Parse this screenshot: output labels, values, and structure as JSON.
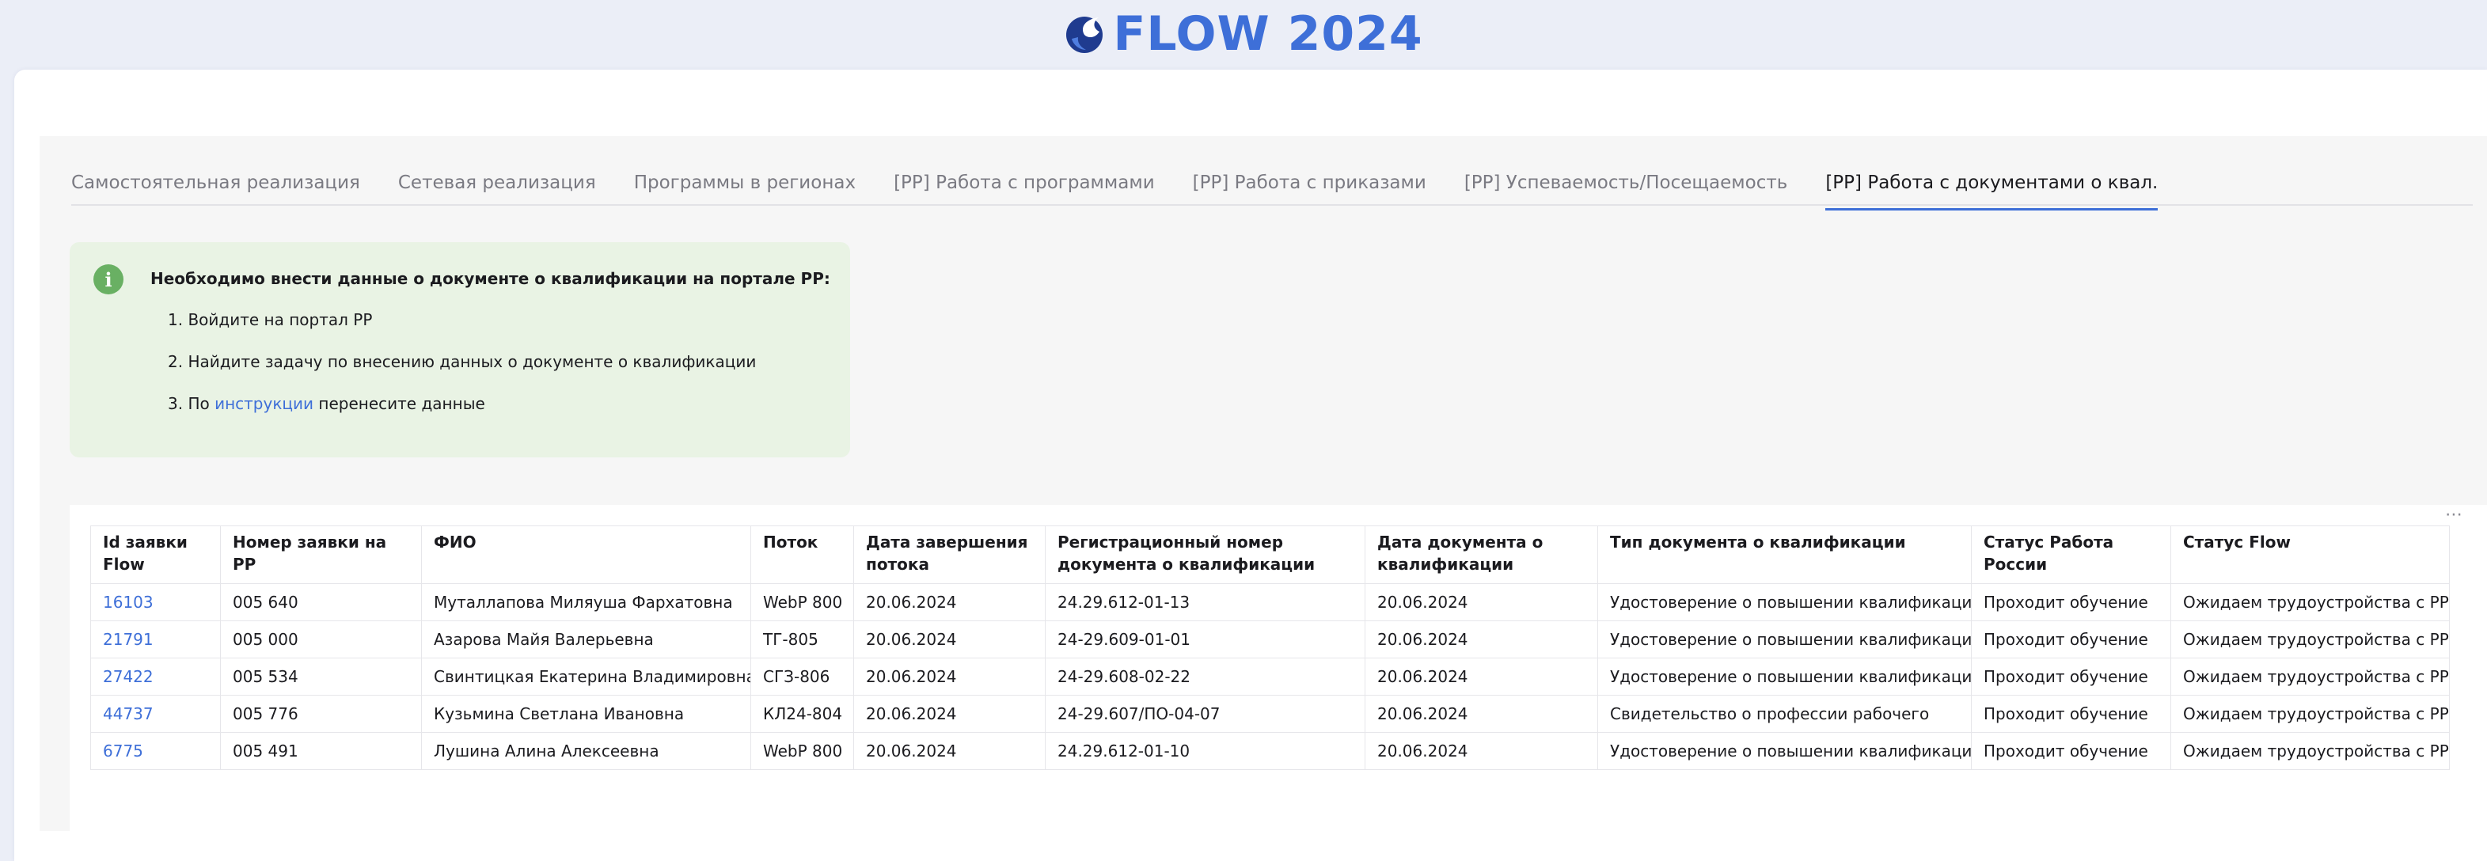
{
  "header": {
    "title": "FLOW 2024"
  },
  "tabs": [
    {
      "label": "Самостоятельная реализация",
      "active": false
    },
    {
      "label": "Сетевая реализация",
      "active": false
    },
    {
      "label": "Программы в регионах",
      "active": false
    },
    {
      "label": "[РР] Работа с программами",
      "active": false
    },
    {
      "label": "[РР] Работа с приказами",
      "active": false
    },
    {
      "label": "[РР] Успеваемость/Посещаемость",
      "active": false
    },
    {
      "label": "[РР] Работа с документами о квал.",
      "active": true
    }
  ],
  "alert": {
    "title": "Необходимо внести данные о документе о квалификации на портале РР:",
    "step1": "1. Войдите на портал РР",
    "step2": "2. Найдите задачу по внесению данных о документе о квалификации",
    "step3_prefix": "3. По ",
    "step3_link": "инструкции",
    "step3_suffix": " перенесите данные",
    "color": "#e9f3e4"
  },
  "table": {
    "menu_label": "⋯",
    "columns": [
      "Id заявки Flow",
      "Номер заявки на РР",
      "ФИО",
      "Поток",
      "Дата завершения потока",
      "Регистрационный номер документа о квалификации",
      "Дата документа о квалификации",
      "Тип документа о квалификации",
      "Статус Работа России",
      "Статус Flow"
    ],
    "rows": [
      [
        "16103",
        "005 640",
        "Муталлапова Миляуша Фархатовна",
        "WebP 800",
        "20.06.2024",
        "24.29.612-01-13",
        "20.06.2024",
        "Удостоверение о повышении квалификации",
        "Проходит обучение",
        "Ожидаем трудоустройства с РР"
      ],
      [
        "21791",
        "005 000",
        "Азарова Майя Валерьевна",
        "ТГ-805",
        "20.06.2024",
        "24-29.609-01-01",
        "20.06.2024",
        "Удостоверение о повышении квалификации",
        "Проходит обучение",
        "Ожидаем трудоустройства с РР"
      ],
      [
        "27422",
        "005 534",
        "Свинтицкая Екатерина Владимировна",
        "СГЗ-806",
        "20.06.2024",
        "24-29.608-02-22",
        "20.06.2024",
        "Удостоверение о повышении квалификации",
        "Проходит обучение",
        "Ожидаем трудоустройства с РР"
      ],
      [
        "44737",
        "005 776",
        "Кузьмина Светлана Ивановна",
        "КЛ24-804",
        "20.06.2024",
        "24-29.607/ПО-04-07",
        "20.06.2024",
        "Свидетельство о профессии рабочего",
        "Проходит обучение",
        "Ожидаем трудоустройства с РР"
      ],
      [
        "6775",
        "005 491",
        "Лушина Алина Алексеевна",
        "WebP 800",
        "20.06.2024",
        "24.29.612-01-10",
        "20.06.2024",
        "Удостоверение о повышении квалификации",
        "Проходит обучение",
        "Ожидаем трудоустройства с РР"
      ]
    ]
  },
  "colors": {
    "accent": "#3e6fd8",
    "info_icon": "#69b063"
  }
}
